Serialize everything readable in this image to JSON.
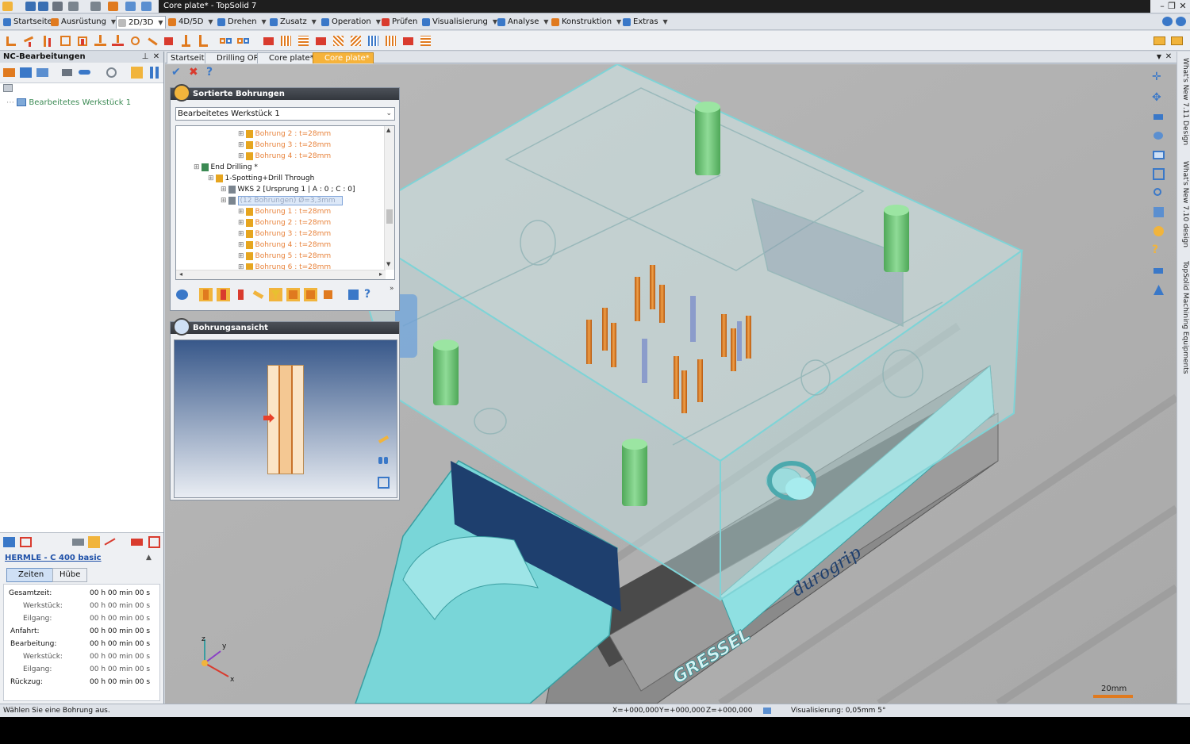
{
  "window": {
    "title": "Core plate* - TopSolid 7"
  },
  "menus": [
    {
      "label": "Startseite",
      "color": "#3a78c8"
    },
    {
      "label": "Ausrüstung",
      "color": "#e07a1f"
    },
    {
      "label": "2D/3D",
      "color": "#e6e6e6"
    },
    {
      "label": "4D/5D",
      "color": "#e07a1f"
    },
    {
      "label": "Drehen",
      "color": "#3a78c8"
    },
    {
      "label": "Zusatz",
      "color": "#3a78c8"
    },
    {
      "label": "Operation",
      "color": "#3a78c8"
    },
    {
      "label": "Prüfen",
      "color": "#d93b2e"
    },
    {
      "label": "Visualisierung",
      "color": "#3a78c8"
    },
    {
      "label": "Analyse",
      "color": "#3a78c8"
    },
    {
      "label": "Konstruktion",
      "color": "#e07a1f"
    },
    {
      "label": "Extras",
      "color": "#3a78c8"
    }
  ],
  "left_panel": {
    "title": "NC-Bearbeitungen",
    "tree_root": "Bearbeitetes Werkstück 1",
    "machine": "HERMLE - C 400 basic",
    "tabs": [
      "Zeiten",
      "Hübe"
    ],
    "times": [
      {
        "label": "Gesamtzeit:",
        "value": "00 h 00 min 00 s",
        "indent": false
      },
      {
        "label": "Werkstück:",
        "value": "00 h 00 min 00 s",
        "indent": true
      },
      {
        "label": "Eilgang:",
        "value": "00 h 00 min 00 s",
        "indent": true
      },
      {
        "label": "Anfahrt:",
        "value": "00 h 00 min 00 s",
        "indent": false
      },
      {
        "label": "Bearbeitung:",
        "value": "00 h 00 min 00 s",
        "indent": false
      },
      {
        "label": "Werkstück:",
        "value": "00 h 00 min 00 s",
        "indent": true
      },
      {
        "label": "Eilgang:",
        "value": "00 h 00 min 00 s",
        "indent": true
      },
      {
        "label": "Rückzug:",
        "value": "00 h 00 min 00 s",
        "indent": false
      }
    ]
  },
  "doc_tabs": [
    {
      "label": "Startseite",
      "active": false
    },
    {
      "label": "Drilling OP",
      "active": false
    },
    {
      "label": "Core plate*",
      "active": false
    },
    {
      "label": "Core plate*",
      "active": true
    }
  ],
  "sorted_panel": {
    "title": "Sortierte Bohrungen",
    "select_value": "Bearbeitetes Werkstück 1",
    "tree": [
      {
        "text": "Bohrung 2 : t=28mm",
        "level": 4,
        "kind": "drill"
      },
      {
        "text": "Bohrung 3 : t=28mm",
        "level": 4,
        "kind": "drill"
      },
      {
        "text": "Bohrung 4 : t=28mm",
        "level": 4,
        "kind": "drill"
      },
      {
        "text": "End Drilling *",
        "level": 1,
        "kind": "op"
      },
      {
        "text": "1-Spotting+Drill Through",
        "level": 2,
        "kind": "tool"
      },
      {
        "text": "WKS 2 [Ursprung 1 | A : 0 ; C : 0]",
        "level": 3,
        "kind": "wcs"
      },
      {
        "text": "(12 Bohrungen) Ø=3,3mm",
        "level": 3,
        "kind": "group"
      },
      {
        "text": "Bohrung 1 : t=28mm",
        "level": 4,
        "kind": "drill"
      },
      {
        "text": "Bohrung 2 : t=28mm",
        "level": 4,
        "kind": "drill"
      },
      {
        "text": "Bohrung 3 : t=28mm",
        "level": 4,
        "kind": "drill"
      },
      {
        "text": "Bohrung 4 : t=28mm",
        "level": 4,
        "kind": "drill"
      },
      {
        "text": "Bohrung 5 : t=28mm",
        "level": 4,
        "kind": "drill"
      },
      {
        "text": "Bohrung 6 : t=28mm",
        "level": 4,
        "kind": "drill"
      }
    ]
  },
  "view_panel": {
    "title": "Bohrungsansicht"
  },
  "right_dock": [
    "What's New 7.11 Design",
    "What's New 7.10 design",
    "TopSolid Machining Equipments"
  ],
  "viewport": {
    "scale_label": "20mm",
    "vise_brand": "GRESSEL",
    "vise_model": "durogrip"
  },
  "status": {
    "message": "Wählen Sie eine Bohrung aus.",
    "x": "X=+000,000",
    "y": "Y=+000,000",
    "z": "Z=+000,000",
    "visual": "Visualisierung: 0,05mm 5°"
  }
}
